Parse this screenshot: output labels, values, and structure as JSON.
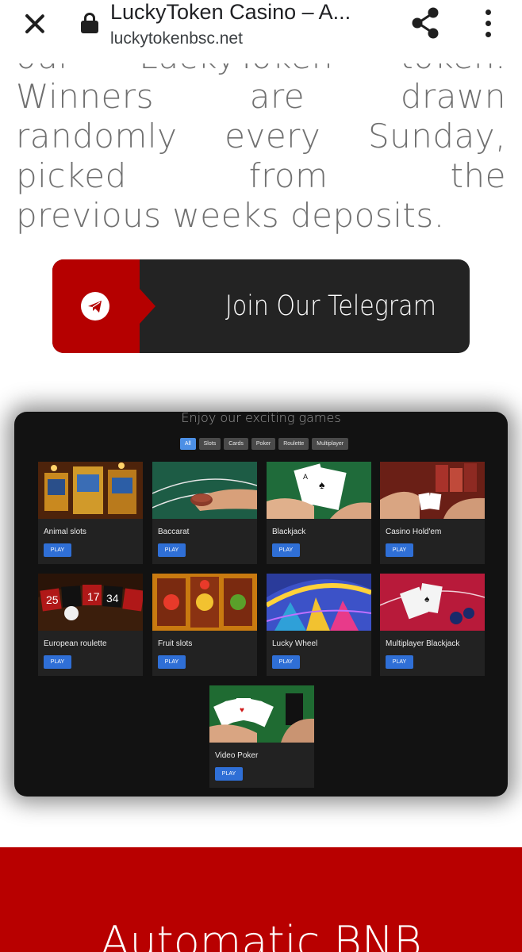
{
  "browser": {
    "page_title": "LuckyToken Casino – A...",
    "url": "luckytokenbsc.net",
    "icons": [
      "close-icon",
      "lock-icon",
      "share-icon",
      "more-vert-icon"
    ]
  },
  "intro": {
    "text_main": "our LuckyToken token. Winners are drawn randomly every Sunday, picked from the",
    "text_last": "previous weeks deposits."
  },
  "telegram": {
    "label": "Join Our Telegram",
    "icon": "telegram-plane-icon",
    "colors": {
      "accent": "#b50000",
      "button": "#232323"
    }
  },
  "games": {
    "title": "Enjoy our exciting games",
    "filters": [
      "All",
      "Slots",
      "Cards",
      "Poker",
      "Roulette",
      "Multiplayer"
    ],
    "active_filter": "All",
    "play_label": "PLAY",
    "items": [
      {
        "name": "Animal slots"
      },
      {
        "name": "Baccarat"
      },
      {
        "name": "Blackjack"
      },
      {
        "name": "Casino Hold'em"
      },
      {
        "name": "European roulette"
      },
      {
        "name": "Fruit slots"
      },
      {
        "name": "Lucky Wheel"
      },
      {
        "name": "Multiplayer Blackjack"
      },
      {
        "name": "Video Poker"
      }
    ]
  },
  "bnb_section": {
    "heading": "Automatic BNB",
    "color": "#b80000"
  }
}
